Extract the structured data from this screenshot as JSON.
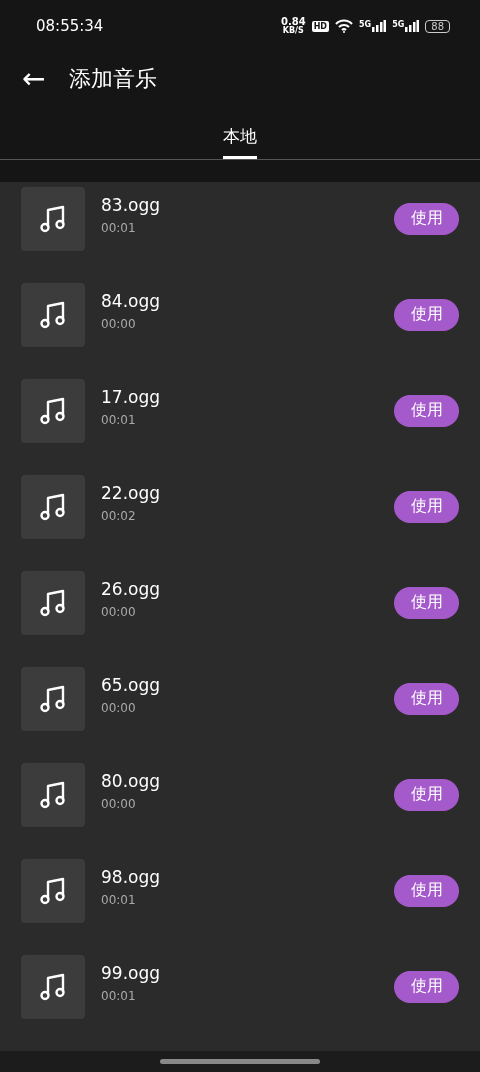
{
  "status_bar": {
    "time": "08:55:34",
    "speed": "0.84",
    "speed_unit": "KB/S",
    "hd": "HD",
    "network_1": "5G",
    "network_2": "5G",
    "battery": "88"
  },
  "header": {
    "back": "←",
    "title": "添加音乐"
  },
  "tabs": [
    {
      "label": "本地",
      "selected": true
    }
  ],
  "tracks": [
    {
      "name": "83.ogg",
      "duration": "00:01",
      "action": "使用"
    },
    {
      "name": "84.ogg",
      "duration": "00:00",
      "action": "使用"
    },
    {
      "name": "17.ogg",
      "duration": "00:01",
      "action": "使用"
    },
    {
      "name": "22.ogg",
      "duration": "00:02",
      "action": "使用"
    },
    {
      "name": "26.ogg",
      "duration": "00:00",
      "action": "使用"
    },
    {
      "name": "65.ogg",
      "duration": "00:00",
      "action": "使用"
    },
    {
      "name": "80.ogg",
      "duration": "00:00",
      "action": "使用"
    },
    {
      "name": "98.ogg",
      "duration": "00:01",
      "action": "使用"
    },
    {
      "name": "99.ogg",
      "duration": "00:01",
      "action": "使用"
    }
  ]
}
